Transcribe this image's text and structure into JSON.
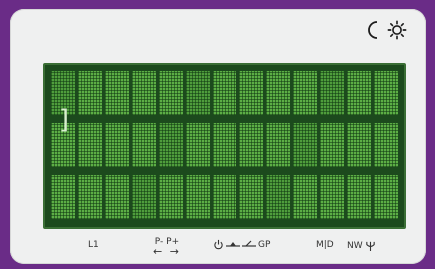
{
  "device": {
    "theme_icons": [
      "moon-icon",
      "sun-icon"
    ]
  },
  "lcd": {
    "rows": 3,
    "columns": 13,
    "cursor_bracket": "]"
  },
  "labels": {
    "l1": "L1",
    "p_minus": "P-",
    "p_plus": "P+",
    "arrow_left": "←",
    "arrow_right": "→",
    "gp": "GP",
    "mid": "M|D",
    "nw": "NW",
    "power_icon": "power-icon",
    "hydrant_icon_1": "hydrant-valve-icon",
    "hydrant_icon_2": "hydrant-valve-icon",
    "antenna_icon": "antenna-icon"
  },
  "colors": {
    "background": "#6a2c87",
    "panel": "#eff0f0",
    "lcd_frame": "#1c4a1d",
    "lcd_cell": "#5cae45"
  }
}
